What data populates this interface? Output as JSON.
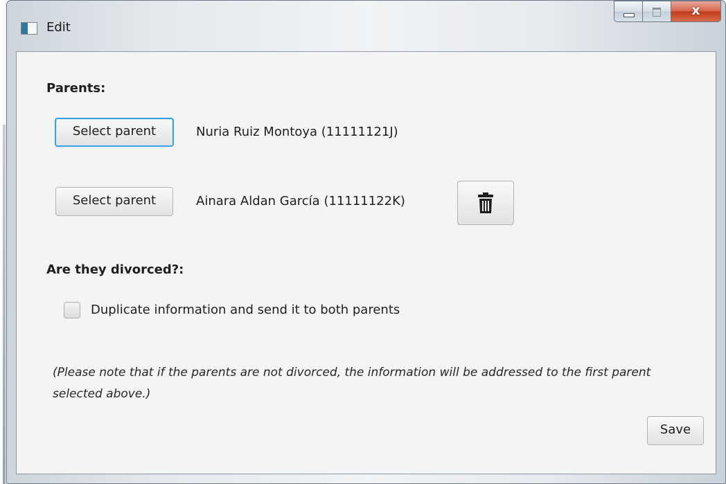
{
  "window": {
    "title": "Edit",
    "close_glyph": "x",
    "icons": {
      "app": "app-window-icon",
      "minimize": "minimize-icon",
      "maximize": "maximize-icon",
      "close": "close-icon"
    }
  },
  "form": {
    "parents_heading": "Parents:",
    "parents": [
      {
        "button_label": "Select parent",
        "name": "Nuria Ruiz Montoya (11111121J)",
        "focused": true,
        "deletable": false
      },
      {
        "button_label": "Select parent",
        "name": "Ainara Aldan García (11111122K)",
        "focused": false,
        "deletable": true
      }
    ],
    "delete_icon": "trash-icon",
    "divorced_heading": "Are they divorced?:",
    "duplicate_checkbox": {
      "label": "Duplicate information and send it to both parents",
      "checked": false
    },
    "note": "(Please note that if the parents are not divorced, the information will be addressed to the first parent selected above.)",
    "save_label": "Save"
  },
  "colors": {
    "focus_ring": "#3d9fe0",
    "close_button": "#c23a1c",
    "content_background": "#f4f4f4"
  }
}
